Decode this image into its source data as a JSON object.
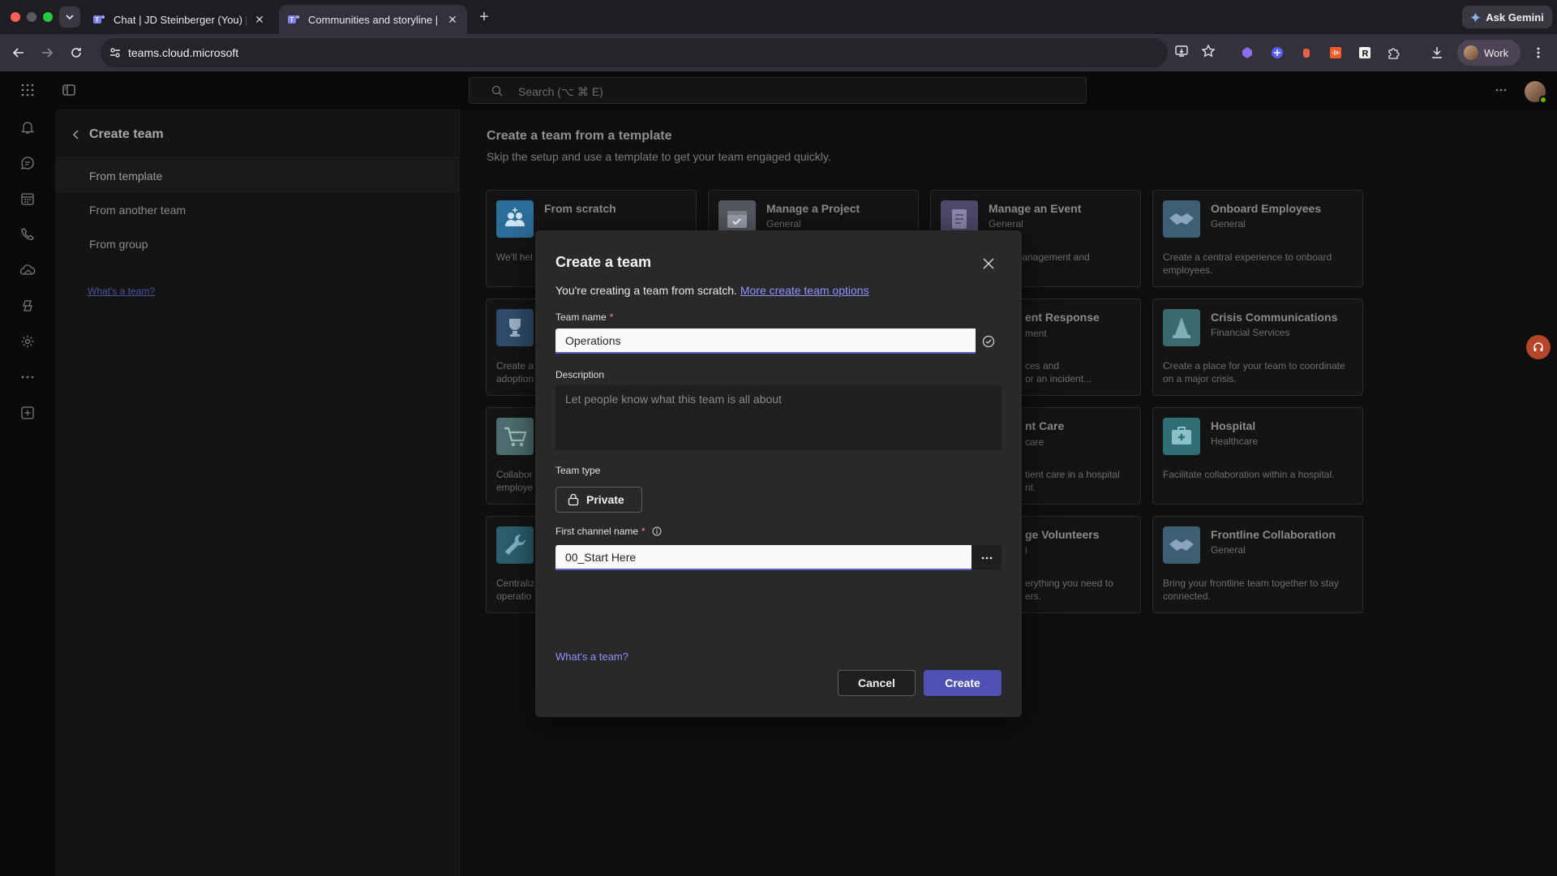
{
  "browser": {
    "tabs": [
      {
        "title": "Chat | JD Steinberger (You) | I",
        "icon": "teams-icon"
      },
      {
        "title": "Communities and storyline | M",
        "icon": "teams-icon"
      }
    ],
    "gemini_label": "Ask Gemini",
    "url": "teams.cloud.microsoft",
    "profile_label": "Work"
  },
  "teams": {
    "search_placeholder": "Search (⌥ ⌘ E)"
  },
  "left_panel": {
    "title": "Create team",
    "items": [
      "From template",
      "From another team",
      "From group"
    ],
    "whats_team_link": "What's a team?"
  },
  "main": {
    "title": "Create a team from a template",
    "subtitle": "Skip the setup and use a template to get your team engaged quickly.",
    "cards": [
      {
        "name": "From scratch",
        "category": "",
        "desc": "We'll hel",
        "color": "#2c6e9a",
        "icon": "people-icon"
      },
      {
        "name": "Manage a Project",
        "category": "General",
        "desc": "",
        "color": "#55575f",
        "icon": "calendar-icon"
      },
      {
        "name": "Manage an Event",
        "category": "General",
        "desc": "nt management and",
        "color": "#4e4a6a",
        "icon": "clipboard-icon"
      },
      {
        "name": "Onboard Employees",
        "category": "General",
        "desc": "Create a central experience to onboard employees.",
        "color": "#3d5f74",
        "icon": "handshake-icon"
      },
      {
        "name": "",
        "category": "",
        "desc": "Create a",
        "desc2": "adoption",
        "color": "#2f4d6b",
        "icon": "trophy-icon"
      },
      {
        "name": "ent Response",
        "category": "ment",
        "desc": "ces and",
        "desc2": "or an incident...",
        "color": "",
        "icon": ""
      },
      {
        "name": "Crisis Communications",
        "category": "Financial Services",
        "desc": "Create a place for your team to coordinate on a major crisis.",
        "color": "#3a6a6e",
        "icon": "cone-icon"
      },
      {
        "name": "",
        "category": "",
        "desc": "Collabor",
        "desc2": "employe",
        "color": "#4d6e70",
        "icon": "cart-icon"
      },
      {
        "name": "nt Care",
        "category": "care",
        "desc": "tient care in a hospital",
        "desc2": "nt.",
        "color": "",
        "icon": ""
      },
      {
        "name": "Hospital",
        "category": "Healthcare",
        "desc": "Facilitate collaboration within a hospital.",
        "color": "#2f6e74",
        "icon": "medkit-icon"
      },
      {
        "name": "",
        "category": "",
        "desc": "Centraliz",
        "desc2": "operatio",
        "color": "#2b5f6e",
        "icon": "wrench-icon"
      },
      {
        "name": "ge Volunteers",
        "category": "l",
        "desc": "erything you need to",
        "desc2": "ers.",
        "color": "",
        "icon": ""
      },
      {
        "name": "Frontline Collaboration",
        "category": "General",
        "desc": "Bring your frontline team together to stay connected.",
        "color": "#3d5f74",
        "icon": "handshake-icon"
      }
    ]
  },
  "dialog": {
    "title": "Create a team",
    "intro": "You're creating a team from scratch.",
    "intro_link": "More create team options",
    "team_name_label": "Team name",
    "required_mark": "*",
    "team_name_value": "Operations",
    "description_label": "Description",
    "description_placeholder": "Let people know what this team is all about",
    "team_type_label": "Team type",
    "team_type_value": "Private",
    "channel_label": "First channel name",
    "channel_value": "00_Start Here",
    "whats_team_link": "What's a team?",
    "cancel_label": "Cancel",
    "create_label": "Create"
  }
}
